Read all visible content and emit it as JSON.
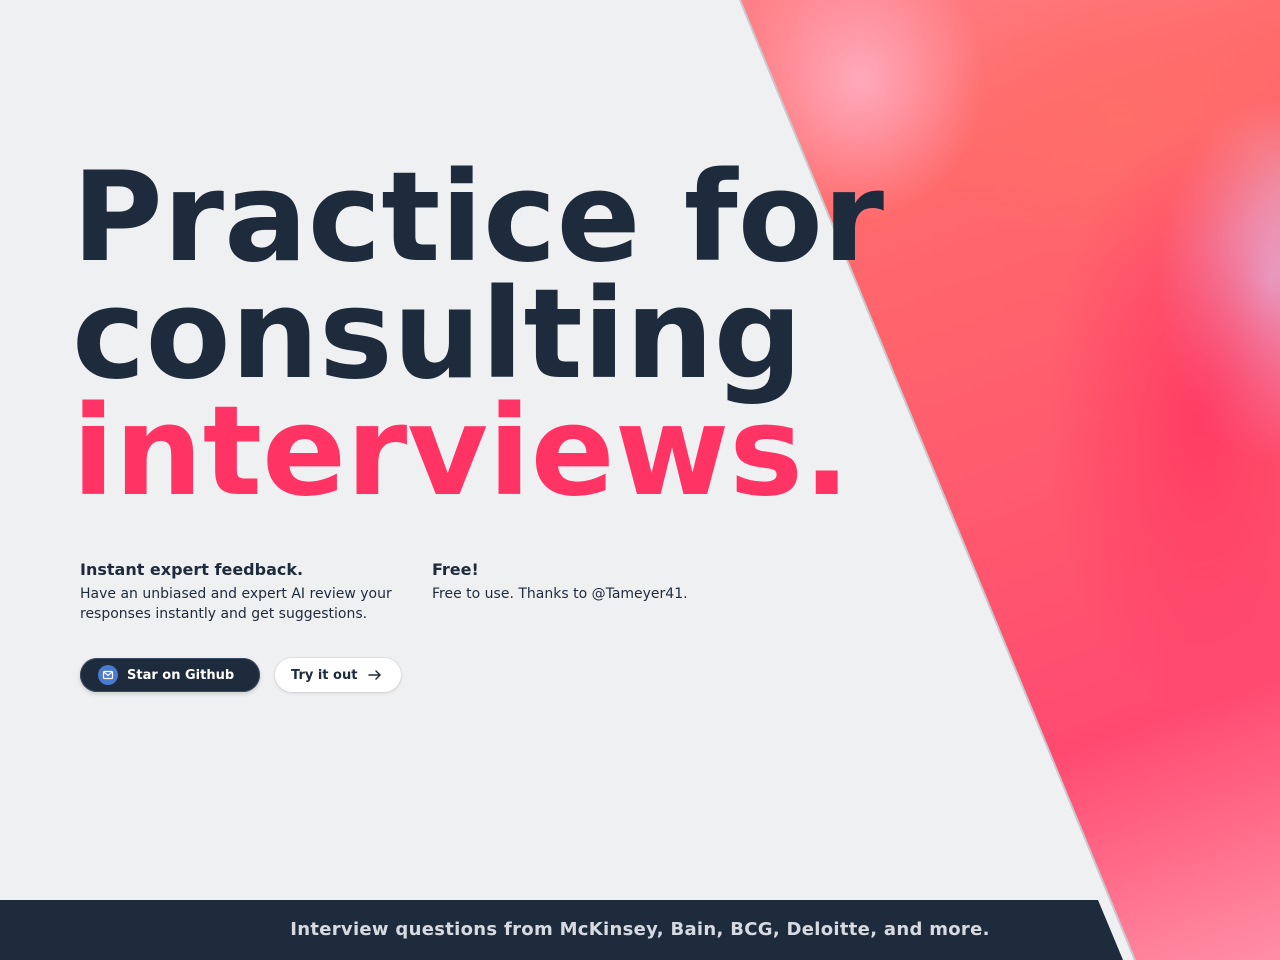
{
  "hero": {
    "line1": "Practice for",
    "line2": "consulting",
    "line3": "interviews."
  },
  "features": [
    {
      "title": "Instant expert feedback.",
      "text": "Have an unbiased and expert AI review your responses instantly and get suggestions."
    },
    {
      "title": "Free!",
      "text": "Free to use. Thanks to @Tameyer41."
    }
  ],
  "buttons": {
    "github_label": "Star on Github",
    "try_label": "Try it out"
  },
  "icons": {
    "github": "mail-icon",
    "try": "arrow-right-icon"
  },
  "footer": {
    "text": "Interview questions from McKinsey, Bain, BCG, Deloitte, and more."
  },
  "colors": {
    "dark": "#1e2b3c",
    "accent": "#ff3465",
    "background": "#eff0f1"
  }
}
